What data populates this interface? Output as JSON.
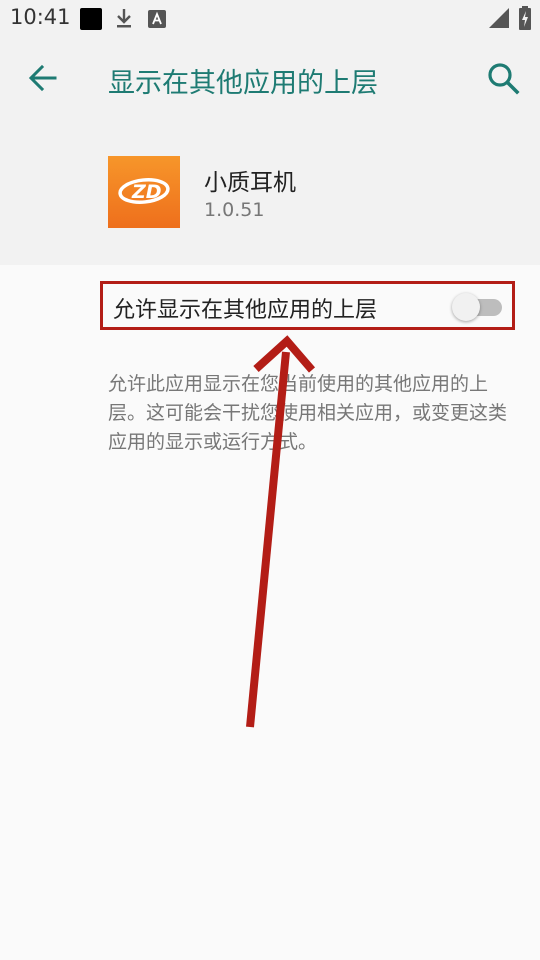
{
  "status_bar": {
    "time": "10:41",
    "icons": [
      "notification-square-icon",
      "download-icon",
      "text-a-icon",
      "signal-icon",
      "battery-charging-icon"
    ]
  },
  "app_bar": {
    "back_icon": "arrow-left-icon",
    "title": "显示在其他应用的上层",
    "search_icon": "search-icon"
  },
  "app_info": {
    "name": "小质耳机",
    "version": "1.0.51",
    "logo_text": "ZD"
  },
  "permission": {
    "label": "允许显示在其他应用的上层",
    "enabled": false
  },
  "description": "允许此应用显示在您当前使用的其他应用的上层。这可能会干扰您使用相关应用，或变更这类应用的显示或运行方式。",
  "colors": {
    "accent": "#1e7b73",
    "highlight": "#b31d16",
    "app_icon": "#f27f22"
  }
}
